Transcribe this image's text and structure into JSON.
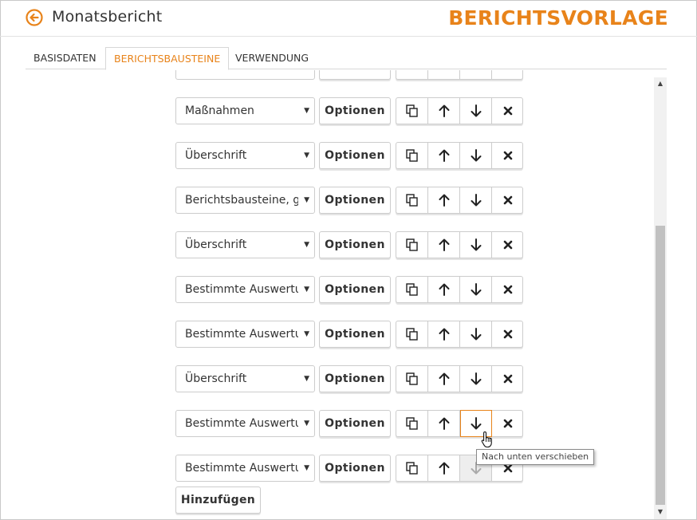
{
  "header": {
    "title": "Monatsbericht",
    "brand": "BERICHTSVORLAGE"
  },
  "tabs": [
    {
      "label": "BASISDATEN",
      "active": false
    },
    {
      "label": "BERICHTSBAUSTEINE",
      "active": true
    },
    {
      "label": "VERWENDUNG",
      "active": false
    }
  ],
  "rows": [
    {
      "value": "Maßnahmen"
    },
    {
      "value": "Überschrift"
    },
    {
      "value": "Berichtsbausteine, gruppiert"
    },
    {
      "value": "Überschrift"
    },
    {
      "value": "Bestimmte Auswertung"
    },
    {
      "value": "Bestimmte Auswertung"
    },
    {
      "value": "Überschrift"
    },
    {
      "value": "Bestimmte Auswertung"
    },
    {
      "value": "Bestimmte Auswertung"
    }
  ],
  "options_label": "Optionen",
  "add_label": "Hinzufügen",
  "tooltip": "Nach unten verschieben",
  "colors": {
    "accent": "#e8831a"
  },
  "icons": [
    "back-arrow-icon",
    "copy-icon",
    "arrow-up-icon",
    "arrow-down-icon",
    "close-icon",
    "caret-down-icon",
    "hand-pointer-icon"
  ]
}
